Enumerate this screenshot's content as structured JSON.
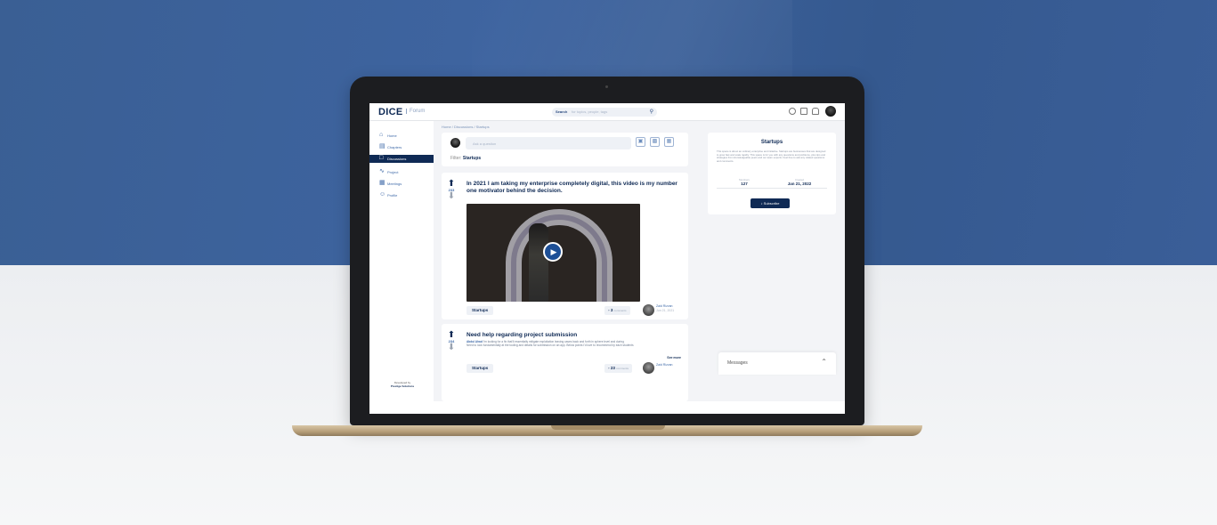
{
  "app": {
    "logo": "DICE",
    "logo_sub": "Forum"
  },
  "header": {
    "search_label": "Search",
    "search_placeholder": "for topics, people, tags",
    "search_icon": "search-icon",
    "icons": [
      "globe-icon",
      "calendar-icon",
      "bell-icon"
    ]
  },
  "sidebar": {
    "items": [
      {
        "label": "Home",
        "icon": "home-icon"
      },
      {
        "label": "Chapters",
        "icon": "chapters-icon"
      },
      {
        "label": "Discussions",
        "icon": "discussions-icon",
        "active": true
      },
      {
        "label": "Project",
        "icon": "project-icon"
      },
      {
        "label": "Meetings",
        "icon": "meetings-icon"
      },
      {
        "label": "Profile",
        "icon": "profile-icon"
      }
    ],
    "powered_by": "Developed by",
    "powered_by_org": "Prestige Solutions"
  },
  "breadcrumb": "Home / Discussions / Startups",
  "composer": {
    "placeholder": "Ask a question",
    "filter_label": "Filter:",
    "filter_value": "Startups"
  },
  "posts": [
    {
      "votes": "233",
      "title": "In 2021 I am taking my enterprise completely digital, this video is my number one motivator behind the decision.",
      "tag": "Startups",
      "comments_count": "3",
      "comments_label": "comments",
      "author": "Zaid Rizvan",
      "date": "Jun 21, 2021"
    },
    {
      "votes": "234",
      "title": "Need help regarding project submission",
      "body_author": "Abdul Ahad",
      "body": "I'm looking for a fix that'll essentially mitigate exploitation leaving cases back and forth in sphere level and during",
      "body2": "Need to look fundamentally at the tooling and details for submission on an app. Below points I'd love to recommend by each students",
      "see_more": "See more",
      "tag": "Startups",
      "comments_count": "23",
      "comments_label": "comments",
      "author": "Zaid Rizvan"
    }
  ],
  "panel": {
    "title": "Startups",
    "description": "This space is about an ordinary enterprise and initiative. Startups are businesses that are designed to grow fast and scale rapidly. This space is for you with any questions and problems, plus tips and strategies from knowledgeable peers and our team experts. Feel free to ask any related questions and comments.",
    "stat1_label": "Members",
    "stat1_value": "127",
    "stat2_label": "Created",
    "stat2_value": "Jan 21, 2022",
    "subscribe": "Subscribe"
  },
  "messages": {
    "label": "Messages"
  },
  "colors": {
    "brand": "#0f2a55",
    "accent": "#1d4f96",
    "backdrop_top": "#3e64a0"
  }
}
